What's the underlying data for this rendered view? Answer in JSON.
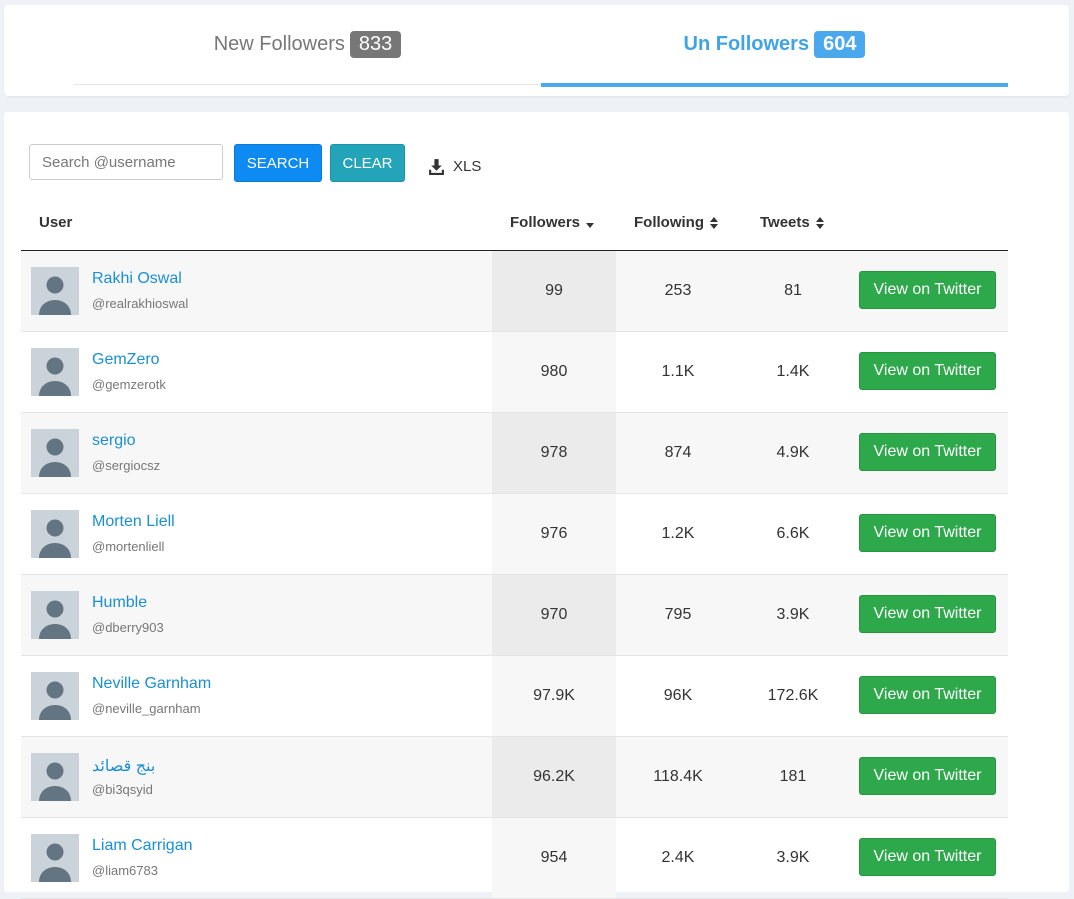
{
  "tabs": {
    "new_followers": {
      "label": "New Followers",
      "count": "833"
    },
    "un_followers": {
      "label": "Un Followers",
      "count": "604"
    }
  },
  "toolbar": {
    "search_placeholder": "Search @username",
    "search_label": "SEARCH",
    "clear_label": "CLEAR",
    "export_label": "XLS",
    "export_icon": "download-icon"
  },
  "table": {
    "headers": {
      "user": "User",
      "followers": "Followers",
      "following": "Following",
      "tweets": "Tweets"
    },
    "sort": {
      "followers": "descending",
      "following": "sortable",
      "tweets": "sortable"
    },
    "rows": [
      {
        "name": "Rakhi Oswal",
        "handle": "@realrakhioswal",
        "followers": "99",
        "following": "253",
        "tweets": "81",
        "action": "View on Twitter"
      },
      {
        "name": "GemZero",
        "handle": "@gemzerotk",
        "followers": "980",
        "following": "1.1K",
        "tweets": "1.4K",
        "action": "View on Twitter"
      },
      {
        "name": "sergio",
        "handle": "@sergiocsz",
        "followers": "978",
        "following": "874",
        "tweets": "4.9K",
        "action": "View on Twitter"
      },
      {
        "name": "Morten Liell",
        "handle": "@mortenliell",
        "followers": "976",
        "following": "1.2K",
        "tweets": "6.6K",
        "action": "View on Twitter"
      },
      {
        "name": "Humble",
        "handle": "@dberry903",
        "followers": "970",
        "following": "795",
        "tweets": "3.9K",
        "action": "View on Twitter"
      },
      {
        "name": "Neville Garnham",
        "handle": "@neville_garnham",
        "followers": "97.9K",
        "following": "96K",
        "tweets": "172.6K",
        "action": "View on Twitter"
      },
      {
        "name": "بنج قصائد",
        "handle": "@bi3qsyid",
        "followers": "96.2K",
        "following": "118.4K",
        "tweets": "181",
        "action": "View on Twitter"
      },
      {
        "name": "Liam Carrigan",
        "handle": "@liam6783",
        "followers": "954",
        "following": "2.4K",
        "tweets": "3.9K",
        "action": "View on Twitter"
      }
    ]
  },
  "colors": {
    "accent": "#4aa8ec",
    "search_button": "#0d8bf2",
    "clear_button": "#23a4b8",
    "view_button": "#2da84a",
    "link": "#1a8fd6"
  }
}
